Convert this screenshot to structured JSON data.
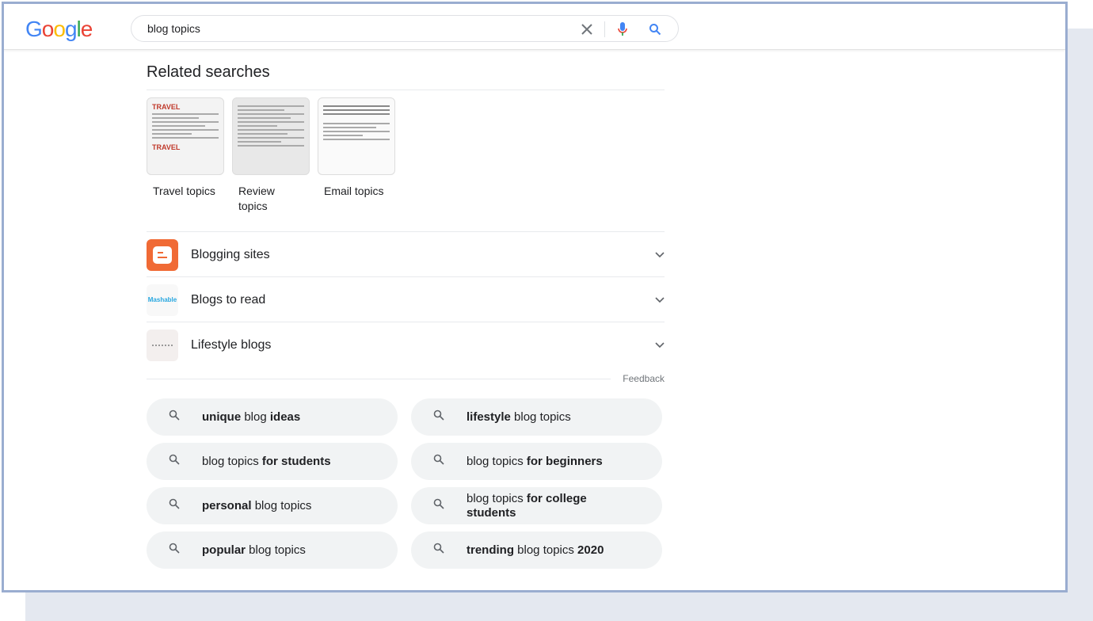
{
  "search": {
    "query": "blog topics",
    "logo": "Google"
  },
  "related": {
    "title": "Related searches",
    "cards": [
      {
        "label": "Travel topics",
        "thumb_text": "TRAVEL"
      },
      {
        "label": "Review topics"
      },
      {
        "label": "Email topics"
      }
    ],
    "accordions": [
      {
        "label": "Blogging sites",
        "icon": "blogger-logo"
      },
      {
        "label": "Blogs to read",
        "icon": "mashable-logo",
        "thumb_text": "Mashable"
      },
      {
        "label": "Lifestyle blogs",
        "icon": "lifestyle-logo"
      }
    ],
    "feedback": "Feedback",
    "pills": [
      [
        {
          "t": "unique",
          "b": true
        },
        {
          "t": " blog "
        },
        {
          "t": "ideas",
          "b": true
        }
      ],
      [
        {
          "t": "lifestyle",
          "b": true
        },
        {
          "t": " blog topics"
        }
      ],
      [
        {
          "t": "blog topics "
        },
        {
          "t": "for students",
          "b": true
        }
      ],
      [
        {
          "t": "blog topics "
        },
        {
          "t": "for beginners",
          "b": true
        }
      ],
      [
        {
          "t": "personal",
          "b": true
        },
        {
          "t": " blog topics"
        }
      ],
      [
        {
          "t": "blog topics "
        },
        {
          "t": "for college students",
          "b": true
        }
      ],
      [
        {
          "t": "popular",
          "b": true
        },
        {
          "t": " blog topics"
        }
      ],
      [
        {
          "t": "trending",
          "b": true
        },
        {
          "t": " blog topics "
        },
        {
          "t": "2020",
          "b": true
        }
      ]
    ]
  },
  "colors": {
    "blogger": "#f06a35",
    "mashable": "#29a8e0"
  }
}
